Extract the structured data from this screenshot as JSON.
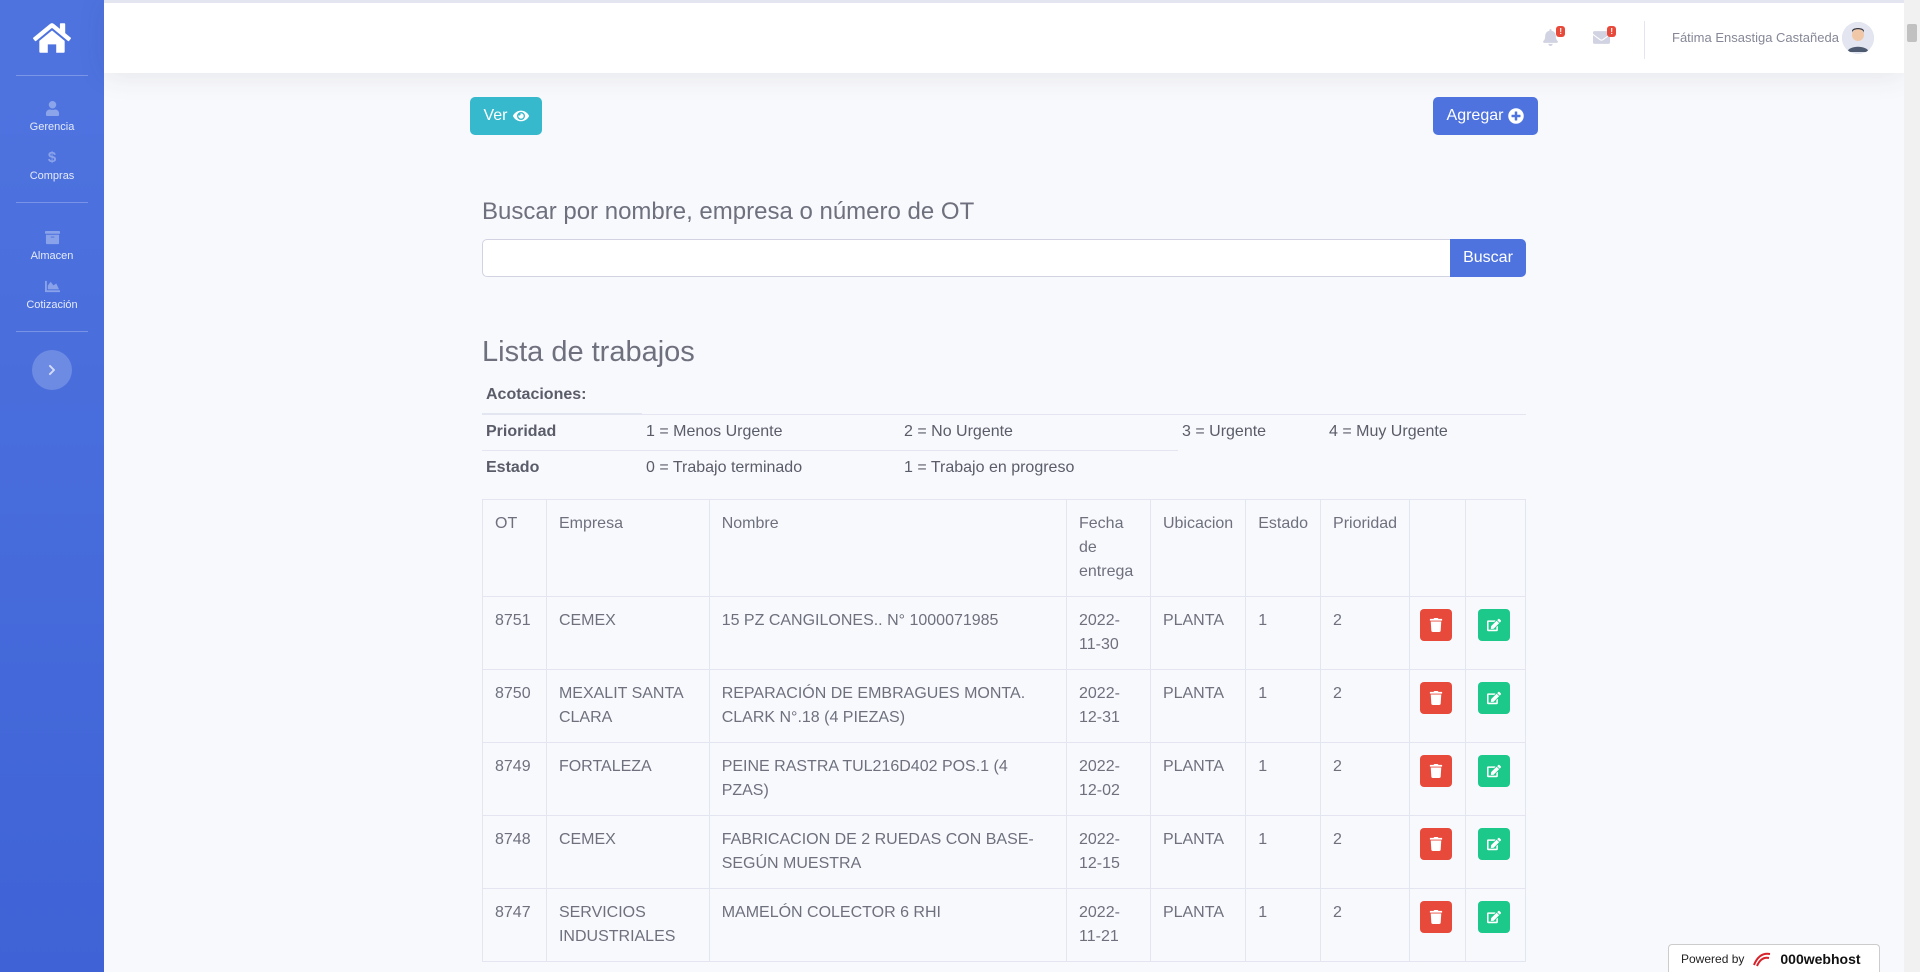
{
  "sidebar": {
    "brand_icon": "home-icon",
    "items": [
      {
        "label": "Gerencia",
        "icon": "user-icon"
      },
      {
        "label": "Compras",
        "icon": "dollar-icon"
      },
      {
        "label": "Almacen",
        "icon": "box-icon"
      },
      {
        "label": "Cotización",
        "icon": "chart-area-icon"
      }
    ]
  },
  "topbar": {
    "alerts_badge": "!",
    "messages_badge": "!",
    "user_name": "Fátima Ensastiga Castañeda"
  },
  "actions": {
    "ver_label": "Ver",
    "agregar_label": "Agregar"
  },
  "search": {
    "title": "Buscar por nombre, empresa o número de OT",
    "value": "",
    "placeholder": "",
    "button_label": "Buscar"
  },
  "list": {
    "title": "Lista de trabajos",
    "notes_header": "Acotaciones:",
    "priority_label": "Prioridad",
    "priority_values": [
      "1 = Menos Urgente",
      "2 = No Urgente",
      "3 = Urgente",
      "4 = Muy Urgente"
    ],
    "status_label": "Estado",
    "status_values": [
      "0 = Trabajo terminado",
      "1 = Trabajo en progreso"
    ]
  },
  "table": {
    "columns": [
      "OT",
      "Empresa",
      "Nombre",
      "Fecha de entrega",
      "Ubicacion",
      "Estado",
      "Prioridad"
    ],
    "rows": [
      {
        "ot": "8751",
        "empresa": "CEMEX",
        "nombre": "15 PZ CANGILONES.. N° 1000071985",
        "fecha": "2022-11-30",
        "ubicacion": "PLANTA",
        "estado": "1",
        "prioridad": "2"
      },
      {
        "ot": "8750",
        "empresa": "MEXALIT SANTA CLARA",
        "nombre": "REPARACIÓN DE EMBRAGUES MONTA. CLARK N°.18 (4 PIEZAS)",
        "fecha": "2022-12-31",
        "ubicacion": "PLANTA",
        "estado": "1",
        "prioridad": "2"
      },
      {
        "ot": "8749",
        "empresa": "FORTALEZA",
        "nombre": "PEINE RASTRA TUL216D402 POS.1 (4 PZAS)",
        "fecha": "2022-12-02",
        "ubicacion": "PLANTA",
        "estado": "1",
        "prioridad": "2"
      },
      {
        "ot": "8748",
        "empresa": "CEMEX",
        "nombre": "FABRICACION DE 2 RUEDAS CON BASE-SEGÚN MUESTRA",
        "fecha": "2022-12-15",
        "ubicacion": "PLANTA",
        "estado": "1",
        "prioridad": "2"
      },
      {
        "ot": "8747",
        "empresa": "SERVICIOS INDUSTRIALES",
        "nombre": "MAMELÓN COLECTOR 6 RHI",
        "fecha": "2022-11-21",
        "ubicacion": "PLANTA",
        "estado": "1",
        "prioridad": "2"
      }
    ]
  },
  "footer": {
    "powered_prefix": "Powered by",
    "powered_brand": "000webhost"
  },
  "colors": {
    "primary": "#4e73df",
    "info": "#36b9cc",
    "danger": "#e74a3b",
    "success": "#1cc88a"
  }
}
